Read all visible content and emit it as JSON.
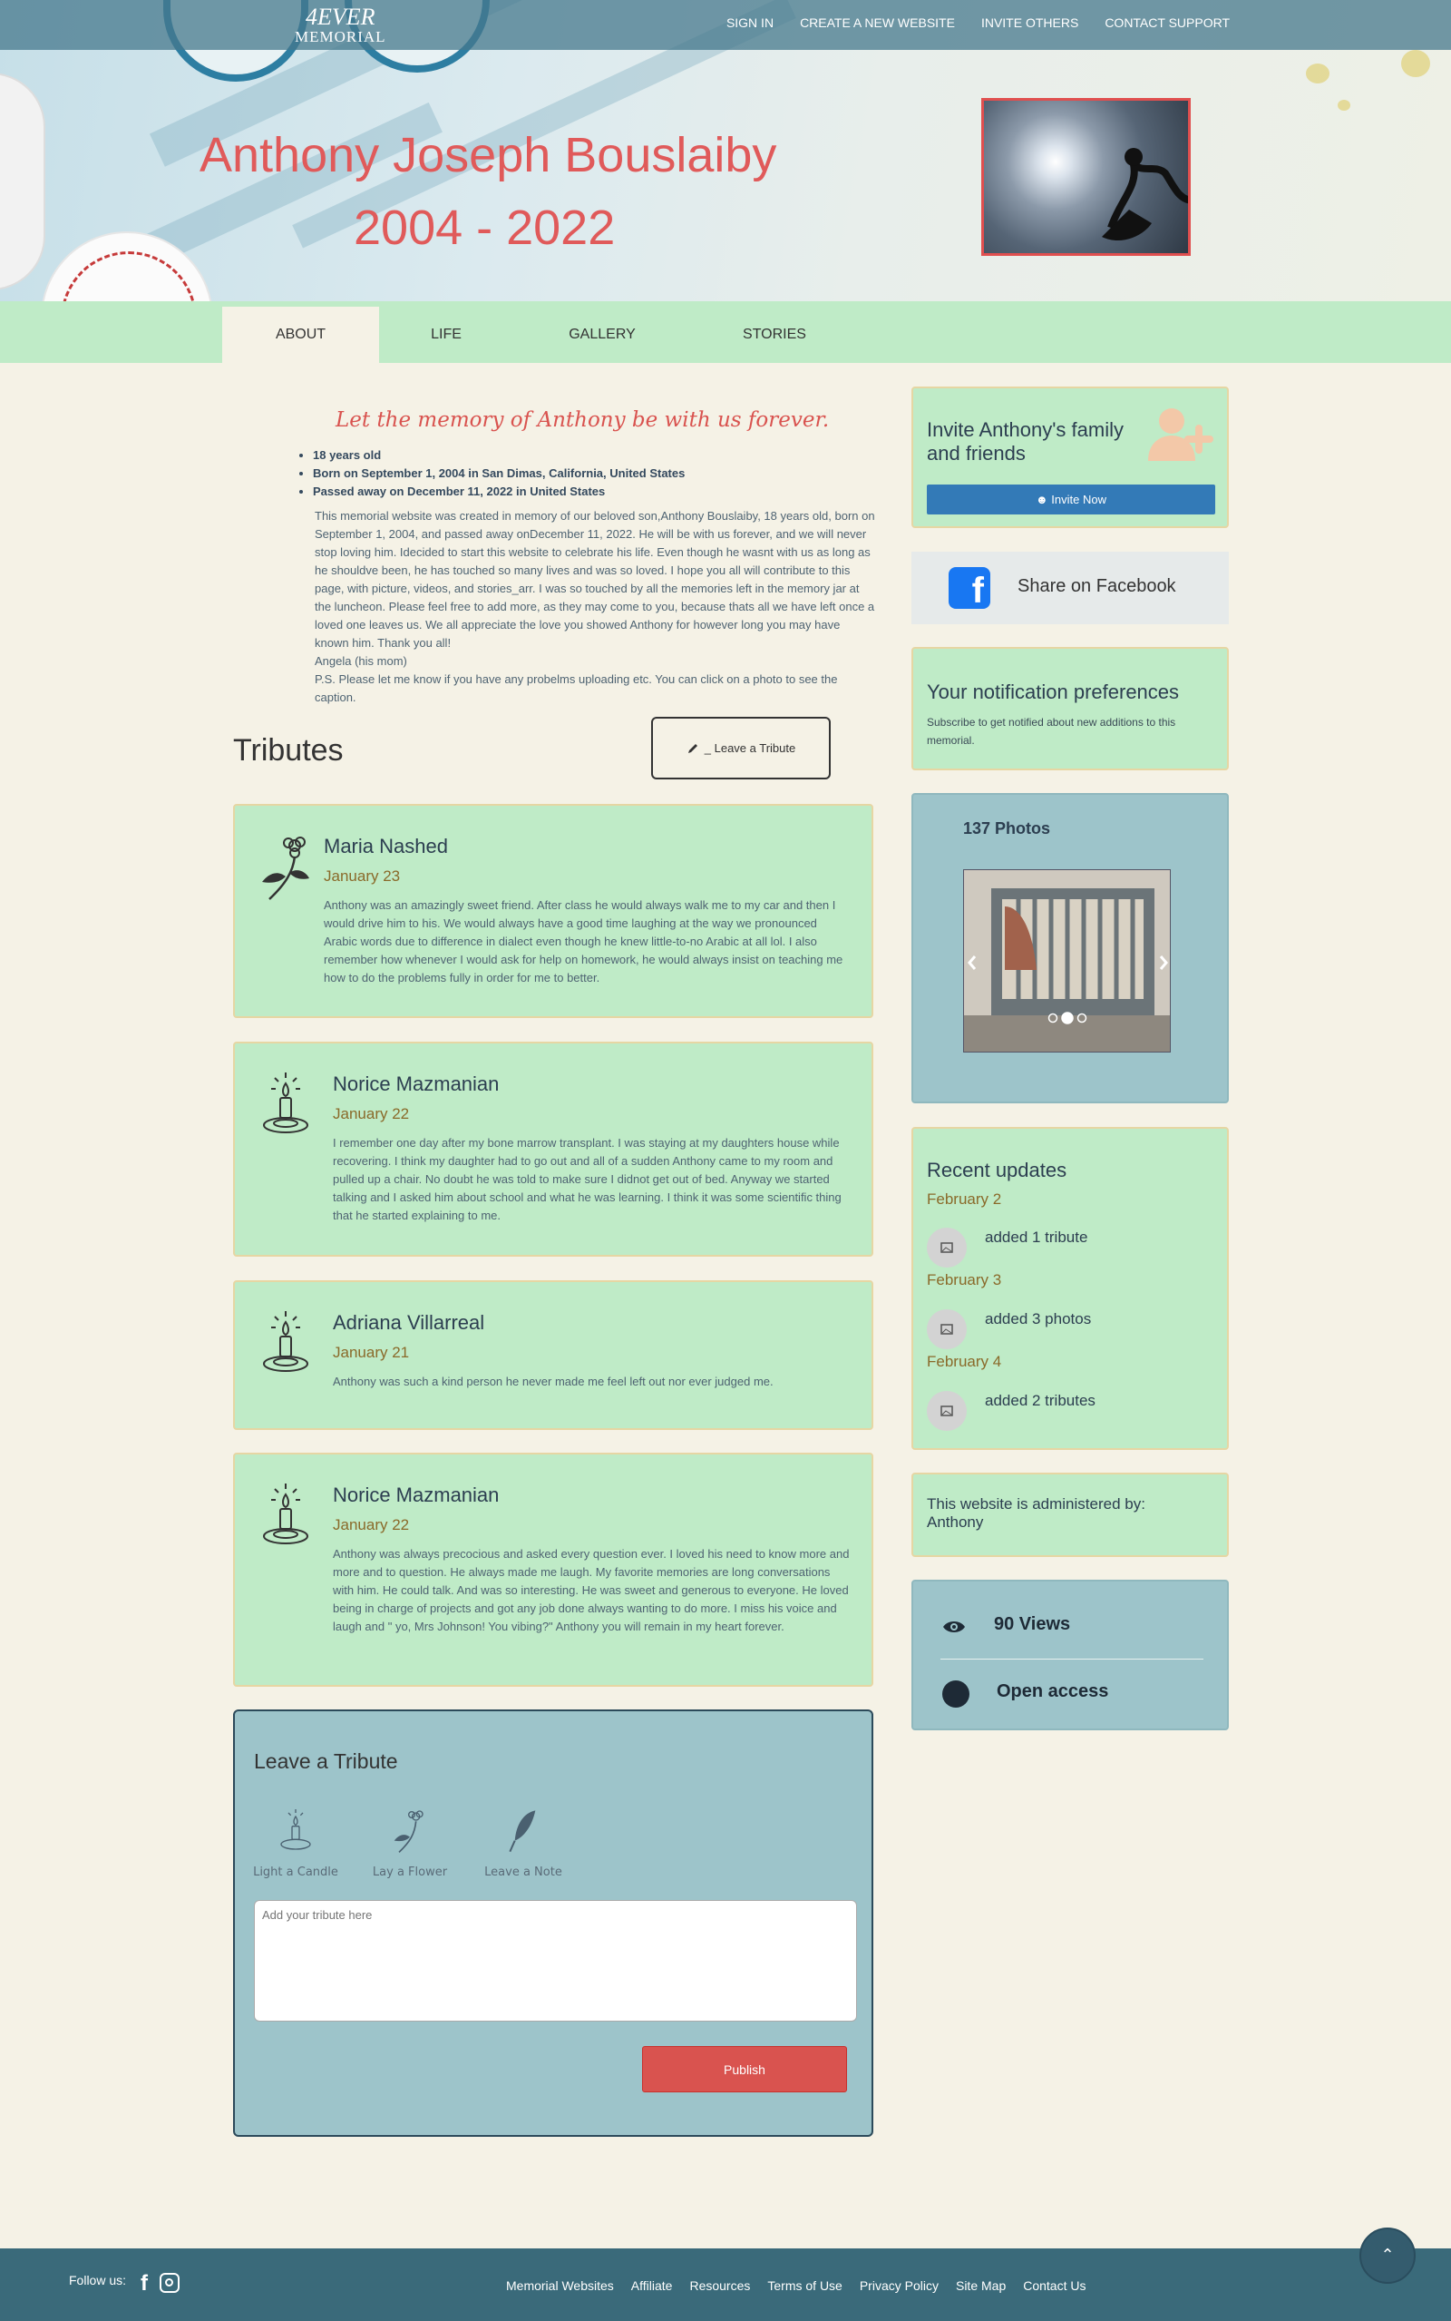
{
  "brand": {
    "line1": "4EVER",
    "line2": "MEMORIAL"
  },
  "topnav": {
    "sign_in": "SIGN IN",
    "create": "CREATE A NEW WEBSITE",
    "invite": "INVITE OTHERS",
    "support": "CONTACT SUPPORT"
  },
  "hero": {
    "name": "Anthony Joseph Bouslaiby",
    "years": "2004 - 2022"
  },
  "tabs": {
    "about": "ABOUT",
    "life": "LIFE",
    "gallery": "GALLERY",
    "stories": "STORIES"
  },
  "about": {
    "motto": "Let the memory of Anthony be with us forever.",
    "facts": [
      "18 years old",
      "Born on September 1, 2004 in San Dimas, California, United States",
      "Passed away on December 11, 2022 in United States"
    ],
    "bio": "This memorial website was created in memory of our beloved son,Anthony Bouslaiby, 18 years old, born on September 1, 2004, and passed away onDecember 11, 2022. He will be with us forever, and we will never stop loving him. Idecided to start this website to celebrate his life. Even though he wasnt with us as long as he shouldve been, he has touched so many lives and was so loved. I hope you all will contribute to this page, with picture, videos, and stories_arr. I was so touched by all the memories left in the memory jar at the luncheon. Please feel free to add more, as they may come to you, because thats all we have left once a loved one leaves us. We all appreciate the love you showed Anthony for however long you may have known him. Thank you all!",
    "signature": "Angela (his mom)",
    "ps": "P.S. Please let me know if you have any probelms uploading etc. You can click on a photo to see the caption."
  },
  "tributes": {
    "title": "Tributes",
    "leave_label": "_ Leave a Tribute",
    "items": [
      {
        "name": "Maria Nashed",
        "date": "January 23",
        "icon": "flower-icon",
        "text": "Anthony was an amazingly sweet friend. After class he would always walk me to my car and then I would drive him to his. We would always have a good time laughing at the way we pronounced Arabic words due to difference in dialect even though he knew little-to-no Arabic at all lol. I also remember how whenever I would ask for help on homework, he would always insist on teaching me how to do the problems fully in order for me to better."
      },
      {
        "name": "Norice Mazmanian",
        "date": "January 22",
        "icon": "candle-icon",
        "text": "I remember one day after my bone marrow transplant. I was staying at my daughters house while recovering. I think my daughter had to go out and all of a sudden Anthony came to my room and pulled up a chair. No doubt he was told to make sure I didnot get out of bed. Anyway we started talking and I asked him about school and what he was learning. I think it was some scientific thing that he started explaining to me."
      },
      {
        "name": "Adriana Villarreal",
        "date": "January 21",
        "icon": "candle-icon",
        "text": "Anthony was such a kind person he never made me feel left out nor ever judged me."
      },
      {
        "name": "Norice Mazmanian",
        "date": "January 22",
        "icon": "candle-icon",
        "text": "Anthony was always precocious and asked every question ever. I loved his need to know more and more and to question. He always made me laugh. My favorite memories are long conversations with him. He could talk. And was so interesting. He was sweet and generous to everyone. He loved being in charge of projects and got any job done always wanting to do more. I miss his voice and laugh and \" yo, Mrs Johnson! You vibing?\" Anthony you will remain in my heart forever."
      }
    ]
  },
  "leave_form": {
    "title": "Leave a Tribute",
    "options": [
      "Light a Candle",
      "Lay a Flower",
      "Leave a Note"
    ],
    "placeholder": "Add your tribute here",
    "publish": "Publish"
  },
  "sidebar": {
    "invite_title": "Invite Anthony's family and friends",
    "invite_button": "Invite Now",
    "facebook": "Share on Facebook",
    "notif_title": "Your notification preferences",
    "notif_sub": "Subscribe to get notified about new additions to this memorial.",
    "photos_title": "137 Photos",
    "photos_slide": 2,
    "photos_slide_count": 3,
    "updates_title": "Recent updates",
    "updates": [
      {
        "date": "February 2",
        "text": "added 1 tribute"
      },
      {
        "date": "February 3",
        "text": "added 3 photos"
      },
      {
        "date": "February 4",
        "text": "added 2 tributes"
      }
    ],
    "admin": "This website is administered by: Anthony",
    "views": "90 Views",
    "access": "Open access"
  },
  "footer": {
    "follow": "Follow us:",
    "links": [
      "Memorial Websites",
      "Affiliate",
      "Resources",
      "Terms of Use",
      "Privacy Policy",
      "Site Map",
      "Contact Us"
    ]
  },
  "colors": {
    "accent": "#e05a5a",
    "tab_bg": "#bfebc7",
    "card_bg": "#bfebc7",
    "panel_blue": "#9dc4ca",
    "publish": "#d9534f",
    "invite": "#337ab7",
    "footer": "#3a6a7a"
  }
}
